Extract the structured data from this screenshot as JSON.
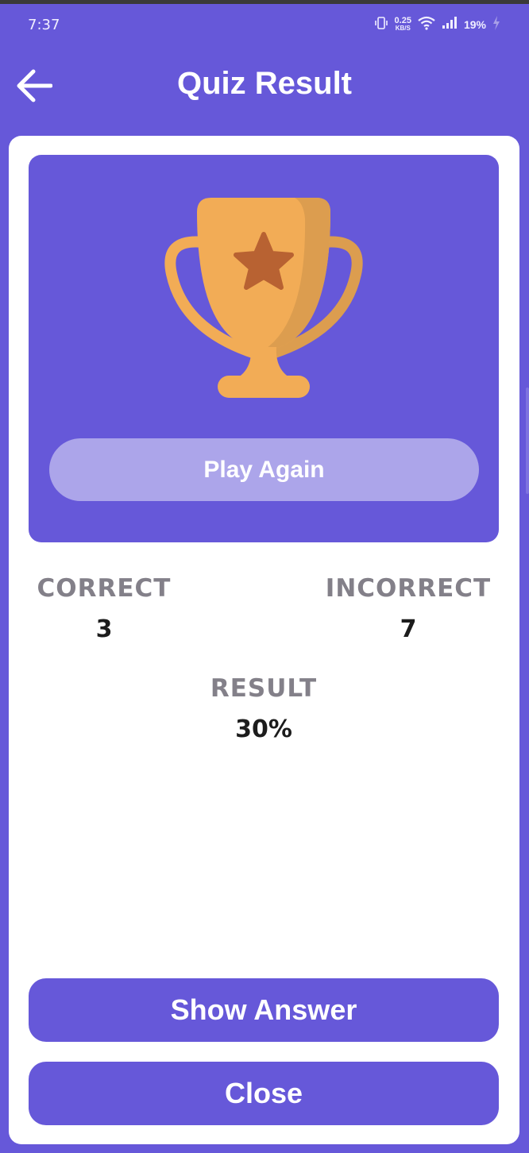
{
  "status_bar": {
    "time": "7:37",
    "net_speed_value": "0.25",
    "net_speed_unit": "KB/S",
    "battery": "19%",
    "icons": [
      "vibrate-icon",
      "wifi-icon",
      "signal-icon",
      "battery-charging-icon"
    ]
  },
  "app_bar": {
    "title": "Quiz Result",
    "back_icon": "arrow-left-icon"
  },
  "hero": {
    "image": "trophy-icon",
    "play_again_label": "Play Again"
  },
  "stats": {
    "correct_label": "CORRECT",
    "correct_value": "3",
    "incorrect_label": "INCORRECT",
    "incorrect_value": "7",
    "result_label": "RESULT",
    "result_value": "30%"
  },
  "actions": {
    "show_answer_label": "Show Answer",
    "close_label": "Close"
  },
  "colors": {
    "primary": "#6658d9",
    "play_again_bg": "#aca5ea",
    "trophy": "#f2ac56",
    "trophy_shade": "#dc9d4f",
    "star": "#b86232",
    "label_gray": "#838089"
  }
}
